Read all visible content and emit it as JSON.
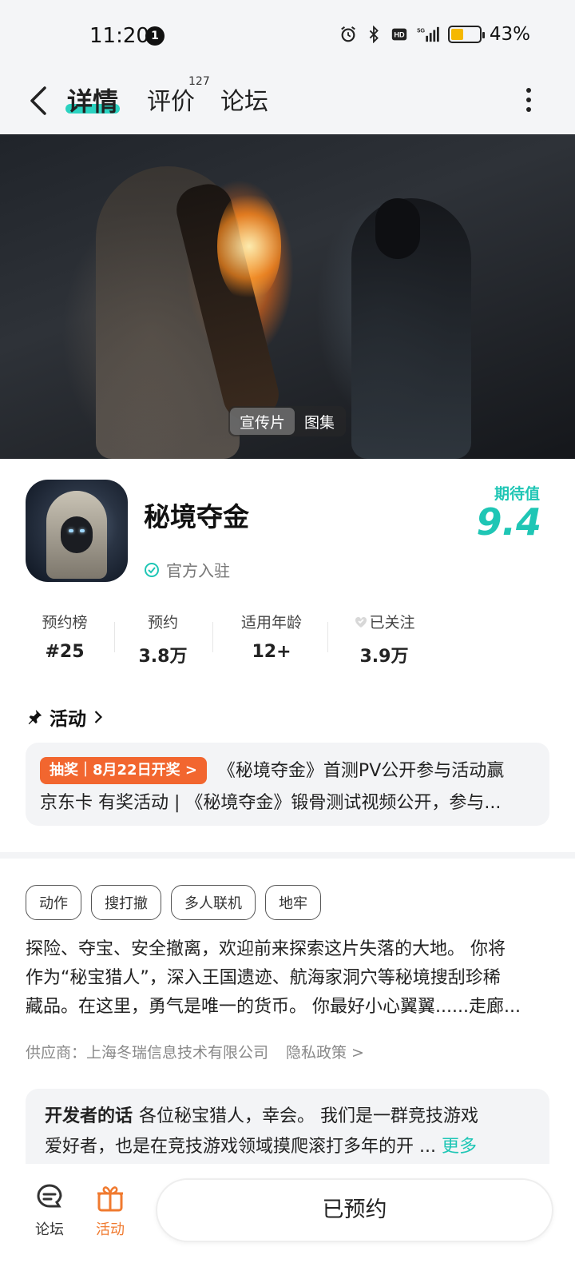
{
  "status_bar": {
    "time": "11:20",
    "notification_count": "1",
    "battery_percent": "43%",
    "battery_level": 0.43,
    "network": "5G"
  },
  "nav": {
    "tabs": [
      {
        "label": "详情"
      },
      {
        "label": "评价",
        "badge": "127"
      },
      {
        "label": "论坛"
      }
    ]
  },
  "hero": {
    "tabs": [
      "宣传片",
      "图集"
    ]
  },
  "game": {
    "name": "秘境夺金",
    "official_label": "官方入驻",
    "expect_label": "期待值",
    "expect_value": "9.4"
  },
  "stats": [
    {
      "label": "预约榜",
      "value": "#25"
    },
    {
      "label": "预约",
      "value": "3.8万"
    },
    {
      "label": "适用年龄",
      "value": "12+"
    },
    {
      "label": "已关注",
      "value": "3.9万"
    }
  ],
  "activity": {
    "title": "活动",
    "badge": "抽奖｜8月22日开奖 >",
    "line1": "《秘境夺金》首测PV公开参与活动赢",
    "line2": "京东卡 有奖活动 | 《秘境夺金》锻骨测试视频公开，参与..."
  },
  "tags": [
    "动作",
    "搜打撤",
    "多人联机",
    "地牢"
  ],
  "description": [
    "探险、夺宝、安全撤离，欢迎前来探索这片失落的大地。 你将",
    "作为“秘宝猎人”，深入王国遗迹、航海家洞穴等秘境搜刮珍稀",
    "藏品。在这里，勇气是唯一的货币。 你最好小心翼翼......走廊..."
  ],
  "supplier": {
    "text": "供应商：上海冬瑞信息技术有限公司",
    "privacy": "隐私政策 >"
  },
  "developer": {
    "title": "开发者的话",
    "line1": "各位秘宝猎人，幸会。 我们是一群竞技游戏",
    "line2": "爱好者，也是在竞技游戏领域摸爬滚打多年的开 ...",
    "more": "更多"
  },
  "bottom_bar": {
    "forum_label": "论坛",
    "activity_label": "活动",
    "reserve_label": "已预约"
  },
  "colors": {
    "accent": "#1fc6b5",
    "orange": "#f2662f",
    "activity_tab": "#f07a2f"
  }
}
